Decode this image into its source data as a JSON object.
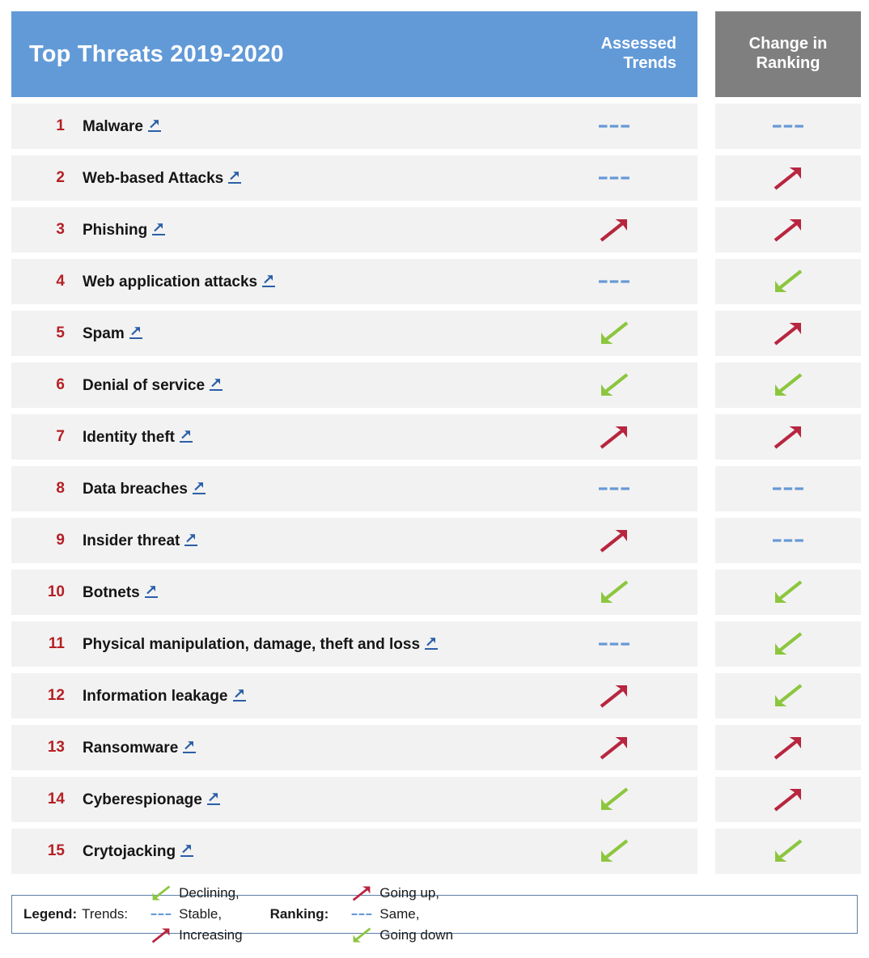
{
  "header": {
    "title": "Top Threats 2019-2020",
    "assessed_trends_label": "Assessed\nTrends",
    "assessed_trends_line1": "Assessed",
    "assessed_trends_line2": "Trends",
    "change_in_ranking_line1": "Change in",
    "change_in_ranking_line2": "Ranking"
  },
  "colors": {
    "header_blue": "#629ad7",
    "header_gray": "#7f7f7f",
    "row_bg": "#f2f2f2",
    "rank_number_red": "#b52025",
    "increasing_red": "#b8253f",
    "declining_green": "#8cc63e",
    "stable_blue": "#6699d6",
    "link_blue": "#2b5fa8",
    "legend_border": "#5b7fa6"
  },
  "icons": {
    "external_link": "external-link-icon",
    "increasing": "arrow-up-right-icon",
    "declining": "arrow-down-left-icon",
    "stable": "dashes-stable-icon"
  },
  "rows": [
    {
      "rank": "1",
      "name": "Malware",
      "trend": "stable",
      "ranking_change": "stable"
    },
    {
      "rank": "2",
      "name": "Web-based Attacks",
      "trend": "stable",
      "ranking_change": "increasing"
    },
    {
      "rank": "3",
      "name": "Phishing",
      "trend": "increasing",
      "ranking_change": "increasing"
    },
    {
      "rank": "4",
      "name": "Web application attacks",
      "trend": "stable",
      "ranking_change": "declining"
    },
    {
      "rank": "5",
      "name": "Spam",
      "trend": "declining",
      "ranking_change": "increasing"
    },
    {
      "rank": "6",
      "name": "Denial of service",
      "trend": "declining",
      "ranking_change": "declining"
    },
    {
      "rank": "7",
      "name": "Identity theft",
      "trend": "increasing",
      "ranking_change": "increasing"
    },
    {
      "rank": "8",
      "name": "Data breaches",
      "trend": "stable",
      "ranking_change": "stable"
    },
    {
      "rank": "9",
      "name": "Insider threat",
      "trend": "increasing",
      "ranking_change": "stable"
    },
    {
      "rank": "10",
      "name": "Botnets",
      "trend": "declining",
      "ranking_change": "declining"
    },
    {
      "rank": "11",
      "name": "Physical manipulation, damage, theft and loss",
      "trend": "stable",
      "ranking_change": "declining"
    },
    {
      "rank": "12",
      "name": "Information leakage",
      "trend": "increasing",
      "ranking_change": "declining"
    },
    {
      "rank": "13",
      "name": "Ransomware",
      "trend": "increasing",
      "ranking_change": "increasing"
    },
    {
      "rank": "14",
      "name": "Cyberespionage",
      "trend": "declining",
      "ranking_change": "increasing"
    },
    {
      "rank": "15",
      "name": "Crytojacking",
      "trend": "declining",
      "ranking_change": "declining"
    }
  ],
  "legend": {
    "title": "Legend:",
    "trends_label": "Trends:",
    "trends_items": [
      {
        "marker": "declining",
        "text": "Declining,"
      },
      {
        "marker": "stable",
        "text": "Stable,"
      },
      {
        "marker": "increasing",
        "text": "Increasing"
      }
    ],
    "ranking_label": "Ranking:",
    "ranking_items": [
      {
        "marker": "increasing",
        "text": "Going up,"
      },
      {
        "marker": "stable",
        "text": "Same,"
      },
      {
        "marker": "declining",
        "text": "Going down"
      }
    ]
  }
}
